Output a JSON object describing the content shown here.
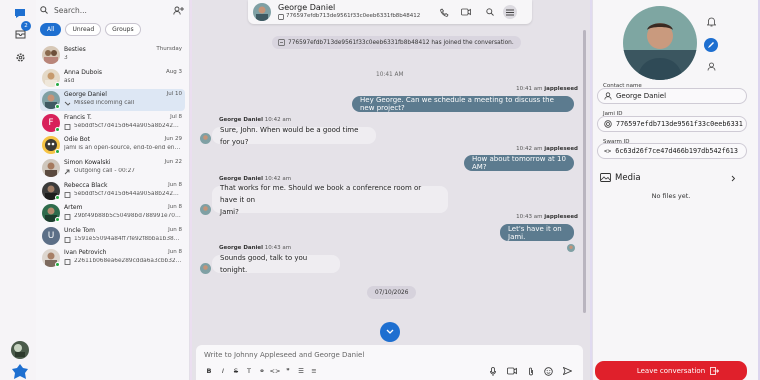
{
  "rail": {
    "badge_count": "2"
  },
  "list": {
    "search_placeholder": "Search...",
    "filters": [
      "All",
      "Unread",
      "Groups"
    ],
    "conversations": [
      {
        "name": "Besties",
        "time": "Thursday",
        "sub": "3"
      },
      {
        "name": "Anna Dubois",
        "time": "Aug 3",
        "sub": "asd"
      },
      {
        "name": "George Daniel",
        "time": "Jul 10",
        "sub": "Missed incoming call"
      },
      {
        "name": "Francis T.",
        "time": "Jul 8",
        "sub": "5ebddf5cf7d415d644a905a8b242b0…"
      },
      {
        "name": "Odie Bot",
        "time": "Jun 29",
        "sub": "Jami is an open-source, end-to-end enc…"
      },
      {
        "name": "Simon Kowalski",
        "time": "Jun 22",
        "sub": "Outgoing call - 00:27"
      },
      {
        "name": "Rebecca Black",
        "time": "Jun 8",
        "sub": "5ebddf5cf7d415d644a905a8b242b0…"
      },
      {
        "name": "Artem",
        "time": "Jun 8",
        "sub": "29bf49b88b5c50498bd788991e705…"
      },
      {
        "name": "Uncle Tom",
        "time": "Jun 8",
        "sub": "1591e55094a84ff7fe92f8bba1b381…"
      },
      {
        "name": "Ivan Petrovich",
        "time": "Jun 8",
        "sub": "22611b068ea6e289cdda6a3cbb323…"
      }
    ]
  },
  "chat": {
    "title": "George Daniel",
    "subtitle": "776597efdb713de9561f33c0eeb6331fb8b48412",
    "system_message": "776597efdb713de9561f33c0eeb6331fb8b48412 has joined the conversation.",
    "time_divider": "10:41 AM",
    "messages": [
      {
        "meta_time": "10:41 am",
        "meta_name": "jappleseed",
        "text": "Hey George. Can we schedule a meeting to discuss the new project?"
      },
      {
        "meta_name": "George Daniel",
        "meta_time": "10:42 am",
        "text": "Sure, John. When would be a good time for you?"
      },
      {
        "meta_time": "10:42 am",
        "meta_name": "jappleseed",
        "text": "How about tomorrow at 10 AM?"
      },
      {
        "meta_name": "George Daniel",
        "meta_time": "10:42 am",
        "text_line1": "That works for me. Should we book a conference room or have it on",
        "text_line2": "Jami?"
      },
      {
        "meta_time": "10:43 am",
        "meta_name": "jappleseed",
        "text": "Let's have it on Jami."
      },
      {
        "meta_name": "George Daniel",
        "meta_time": "10:43 am",
        "text": "Sounds good, talk to you tonight."
      }
    ],
    "date_pill": "07/10/2026",
    "composer_placeholder": "Write to Johnny Appleseed and George Daniel"
  },
  "details": {
    "contact_name_label": "Contact name",
    "contact_name": "George Daniel",
    "jami_id_label": "Jami ID",
    "jami_id": "776597efdb713de9561f33c0eeb6331",
    "swarm_id_label": "Swarm ID",
    "swarm_id": "6c63d26f7ce47d466b197db542f613",
    "media_label": "Media",
    "no_files": "No files yet.",
    "leave_label": "Leave conversation"
  },
  "colors": {
    "accent": "#1e6fd0",
    "outgoing_bubble": "#5c7b8f",
    "danger": "#e0202b",
    "online": "#27a844"
  }
}
